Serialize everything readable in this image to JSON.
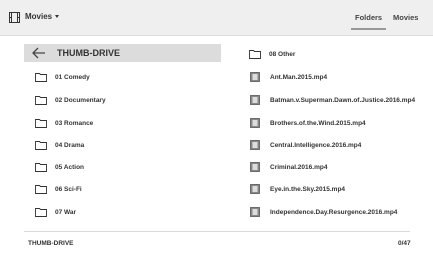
{
  "header": {
    "app_menu_label": "Movies",
    "tabs": [
      {
        "label": "Folders",
        "active": true
      },
      {
        "label": "Movies",
        "active": false
      }
    ]
  },
  "drive": {
    "label": "THUMB-DRIVE"
  },
  "folders": [
    {
      "label": "01 Comedy"
    },
    {
      "label": "02 Documentary"
    },
    {
      "label": "03 Romance"
    },
    {
      "label": "04 Drama"
    },
    {
      "label": "05 Action"
    },
    {
      "label": "06 Sci-Fi"
    },
    {
      "label": "07 War"
    }
  ],
  "right_items": [
    {
      "label": "08 Other",
      "kind": "folder"
    },
    {
      "label": "Ant.Man.2015.mp4",
      "kind": "video"
    },
    {
      "label": "Batman.v.Superman.Dawn.of.Justice.2016.mp4",
      "kind": "video"
    },
    {
      "label": "Brothers.of.the.Wind.2015.mp4",
      "kind": "video"
    },
    {
      "label": "Central.Intelligence.2016.mp4",
      "kind": "video"
    },
    {
      "label": "Criminal.2016.mp4",
      "kind": "video"
    },
    {
      "label": "Eye.in.the.Sky.2015.mp4",
      "kind": "video"
    },
    {
      "label": "Independence.Day.Resurgence.2016.mp4",
      "kind": "video"
    }
  ],
  "footer": {
    "location": "THUMB-DRIVE",
    "count": "0/47"
  },
  "colors": {
    "topbar_bg": "#efefef",
    "selected_row_bg": "#dcdcdc",
    "text": "#333333"
  }
}
